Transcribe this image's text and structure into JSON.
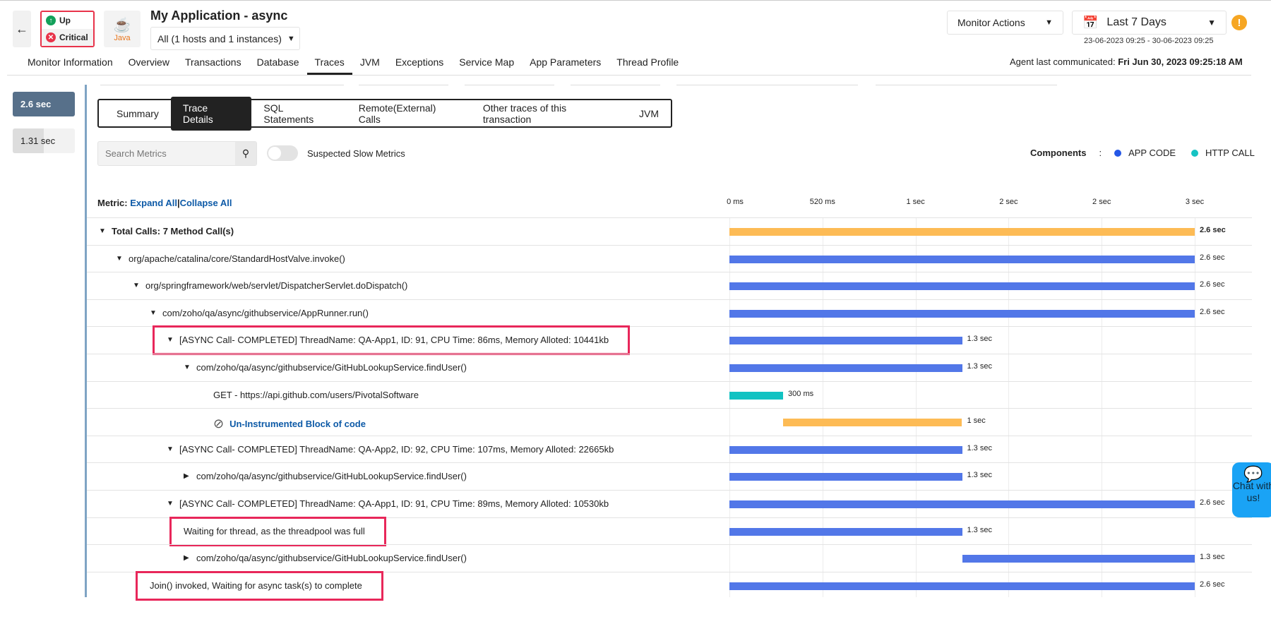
{
  "header": {
    "back_icon": "arrow-left-icon",
    "status_up": "Up",
    "status_critical": "Critical",
    "java_label": "Java",
    "title": "My Application - async",
    "host_select": "All (1 hosts and 1 instances)",
    "monitor_actions": "Monitor Actions",
    "date_range_label": "Last 7 Days",
    "date_range": "23-06-2023 09:25 - 30-06-2023 09:25",
    "agent_prefix": "Agent last communicated: ",
    "agent_time": "Fri Jun 30, 2023 09:25:18 AM"
  },
  "nav": {
    "tabs": [
      "Monitor Information",
      "Overview",
      "Transactions",
      "Database",
      "Traces",
      "JVM",
      "Exceptions",
      "Service Map",
      "App Parameters",
      "Thread Profile"
    ],
    "active": 4
  },
  "traces": [
    {
      "label": "2.6 sec",
      "selected": true
    },
    {
      "label": "1.31 sec",
      "fraction": 0.5
    }
  ],
  "subtabs": {
    "items": [
      "Summary",
      "Trace Details",
      "SQL Statements",
      "Remote(External) Calls",
      "Other traces of this transaction",
      "JVM"
    ],
    "active": 1
  },
  "search": {
    "placeholder": "Search Metrics"
  },
  "slow_toggle": {
    "label": "Suspected Slow Metrics",
    "on": false
  },
  "legend": {
    "title": "Components",
    "sep": ":",
    "items": [
      {
        "label": "APP CODE",
        "color": "#2457e6"
      },
      {
        "label": "HTTP CALL",
        "color": "#16c3c3"
      }
    ]
  },
  "metric": {
    "prefix": "Metric: ",
    "expand": "Expand All",
    "sep": "|",
    "collapse": "Collapse All"
  },
  "colors": {
    "total": "#fdbb55",
    "app": "#5277e8",
    "http": "#11c2c2",
    "uninstr": "#fdbb55",
    "highlight": "#e8275a"
  },
  "chart_data": {
    "type": "bar",
    "axis_ticks": [
      "0 ms",
      "520 ms",
      "1 sec",
      "2 sec",
      "2 sec",
      "3 sec"
    ],
    "xlim_ms": [
      0,
      2600
    ],
    "rows": [
      {
        "label": "Total Calls: 7 Method Call(s)",
        "level": 0,
        "toggle": "down",
        "bold": true,
        "start": 0,
        "duration": 2600,
        "value": "2.6 sec",
        "kind": "total"
      },
      {
        "label": "org/apache/catalina/core/StandardHostValve.invoke()",
        "level": 1,
        "toggle": "down",
        "start": 0,
        "duration": 2600,
        "value": "2.6 sec",
        "kind": "app"
      },
      {
        "label": "org/springframework/web/servlet/DispatcherServlet.doDispatch()",
        "level": 2,
        "toggle": "down",
        "start": 0,
        "duration": 2600,
        "value": "2.6 sec",
        "kind": "app"
      },
      {
        "label": "com/zoho/qa/async/githubservice/AppRunner.run()",
        "level": 3,
        "toggle": "down",
        "start": 0,
        "duration": 2600,
        "value": "2.6 sec",
        "kind": "app"
      },
      {
        "label": "[ASYNC Call- COMPLETED] ThreadName: QA-App1, ID: 91, CPU Time: 86ms, Memory Alloted: 10441kb",
        "level": 4,
        "toggle": "down",
        "start": 0,
        "duration": 1300,
        "value": "1.3 sec",
        "kind": "app",
        "highlight": true
      },
      {
        "label": "com/zoho/qa/async/githubservice/GitHubLookupService.findUser()",
        "level": 5,
        "toggle": "down",
        "start": 0,
        "duration": 1300,
        "value": "1.3 sec",
        "kind": "app"
      },
      {
        "label": "GET - https://api.github.com/users/PivotalSoftware",
        "level": 6,
        "toggle": "none",
        "start": 0,
        "duration": 300,
        "value": "300 ms",
        "kind": "http"
      },
      {
        "label": "Un-Instrumented Block of code",
        "level": 6,
        "toggle": "none",
        "icon": "prohibited-icon",
        "link": true,
        "start": 300,
        "duration": 1000,
        "value": "1 sec",
        "kind": "uninstr"
      },
      {
        "label": "[ASYNC Call- COMPLETED] ThreadName: QA-App2, ID: 92, CPU Time: 107ms, Memory Alloted: 22665kb",
        "level": 4,
        "toggle": "down",
        "start": 0,
        "duration": 1300,
        "value": "1.3 sec",
        "kind": "app"
      },
      {
        "label": "com/zoho/qa/async/githubservice/GitHubLookupService.findUser()",
        "level": 5,
        "toggle": "right",
        "start": 0,
        "duration": 1300,
        "value": "1.3 sec",
        "kind": "app"
      },
      {
        "label": "[ASYNC Call- COMPLETED] ThreadName: QA-App1, ID: 91, CPU Time: 89ms, Memory Alloted: 10530kb",
        "level": 4,
        "toggle": "down",
        "start": 0,
        "duration": 2600,
        "value": "2.6 sec",
        "kind": "app"
      },
      {
        "label": "Waiting for thread, as the threadpool was full",
        "level": 5,
        "toggle": "none",
        "start": 0,
        "duration": 1300,
        "value": "1.3 sec",
        "kind": "app",
        "highlight": true
      },
      {
        "label": "com/zoho/qa/async/githubservice/GitHubLookupService.findUser()",
        "level": 5,
        "toggle": "right",
        "start": 1300,
        "duration": 1300,
        "value": "1.3 sec",
        "kind": "app"
      },
      {
        "label": "Join() invoked, Waiting for async task(s) to complete",
        "level": 3,
        "toggle": "none",
        "start": 0,
        "duration": 2600,
        "value": "2.6 sec",
        "kind": "app",
        "highlight": true
      }
    ]
  },
  "chat": {
    "label": "Chat with us!"
  }
}
